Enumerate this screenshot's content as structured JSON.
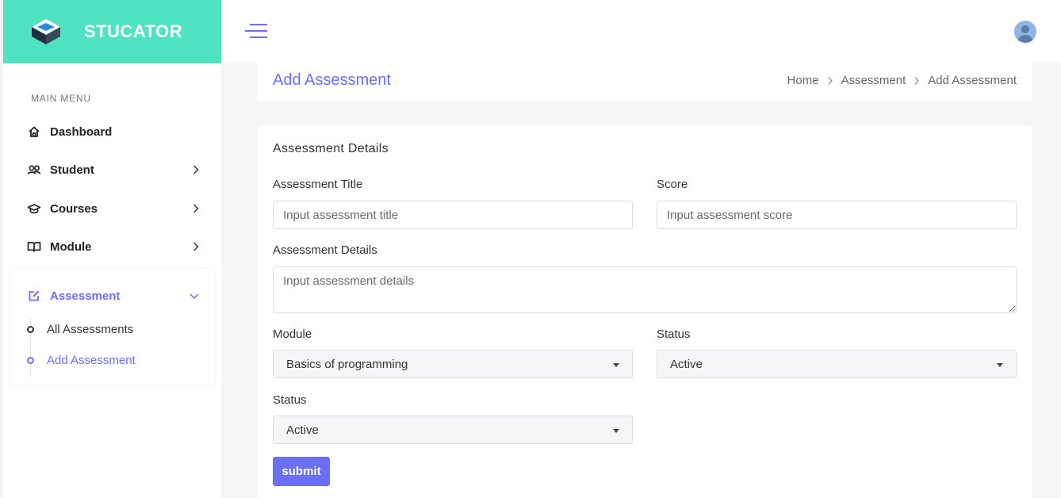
{
  "brand": {
    "name": "STUCATOR"
  },
  "colors": {
    "accent": "#6b6ff5",
    "brand_bg": "#4fe3c1"
  },
  "sidebar": {
    "menu_title": "MAIN MENU",
    "items": [
      {
        "label": "Dashboard",
        "icon": "home-icon"
      },
      {
        "label": "Student",
        "icon": "users-icon"
      },
      {
        "label": "Courses",
        "icon": "graduation-cap-icon"
      },
      {
        "label": "Module",
        "icon": "book-icon"
      },
      {
        "label": "Assessment",
        "icon": "edit-icon"
      }
    ],
    "sub_items": [
      {
        "label": "All Assessments"
      },
      {
        "label": "Add Assessment"
      }
    ]
  },
  "header": {
    "title": "Add Assessment",
    "breadcrumb": [
      "Home",
      "Assessment",
      "Add Assessment"
    ]
  },
  "form": {
    "card_title": "Assessment Details",
    "title_label": "Assessment Title",
    "title_placeholder": "Input assessment title",
    "score_label": "Score",
    "score_placeholder": "Input assessment score",
    "details_label": "Assessment Details",
    "details_placeholder": "Input assessment details",
    "module_label": "Module",
    "module_value": "Basics of programming",
    "status1_label": "Status",
    "status1_value": "Active",
    "status2_label": "Status",
    "status2_value": "Active",
    "submit_label": "submit"
  }
}
